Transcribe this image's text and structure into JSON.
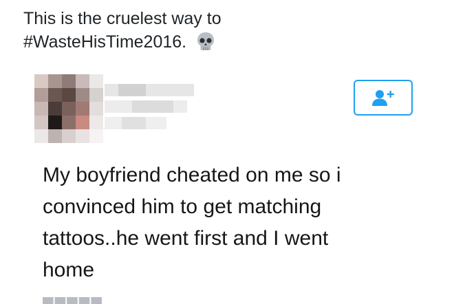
{
  "caption": {
    "line1": "This is the cruelest way to",
    "line2": "#WasteHisTime2016.",
    "emoji_icon": "skull-icon"
  },
  "tweet": {
    "author_avatar_icon": "pixelated-avatar-icon",
    "follow_button_icon": "follow-user-icon",
    "text_lines": [
      "My boyfriend cheated on me so i",
      "convinced him to get matching",
      "tattoos..he went first and I went",
      "home"
    ]
  },
  "colors": {
    "follow_accent": "#1da1f2",
    "text": "#14171a"
  }
}
